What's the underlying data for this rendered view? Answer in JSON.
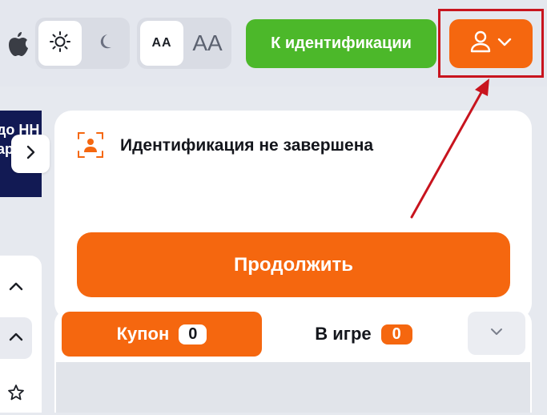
{
  "header": {
    "identification_button": "К идентификации",
    "font_small_label": "AA",
    "font_large_label": "AA"
  },
  "banner": {
    "lines": [
      "до НН",
      "ар"
    ]
  },
  "identification_card": {
    "title": "Идентификация не завершена",
    "continue_button": "Продолжить"
  },
  "coupon_bar": {
    "coupon_label": "Купон",
    "coupon_count": "0",
    "ingame_label": "В игре",
    "ingame_count": "0"
  },
  "colors": {
    "accent_orange": "#f5670f",
    "accent_green": "#4cb82a",
    "annotation_red": "#c8141e",
    "banner_navy": "#121a54"
  },
  "icons": [
    "apple-icon",
    "sun-icon",
    "moon-icon",
    "user-icon",
    "chevron-down-icon",
    "chevron-right-icon",
    "chevron-up-icon",
    "star-icon",
    "id-scan-icon"
  ]
}
